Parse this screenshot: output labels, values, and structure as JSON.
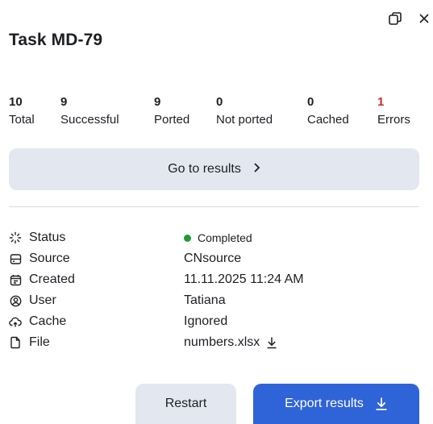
{
  "header": {
    "title": "Task MD-79"
  },
  "stats": [
    {
      "value": "10",
      "label": "Total"
    },
    {
      "value": "9",
      "label": "Successful"
    },
    {
      "value": "9",
      "label": "Ported"
    },
    {
      "value": "0",
      "label": "Not ported"
    },
    {
      "value": "0",
      "label": "Cached"
    },
    {
      "value": "1",
      "label": "Errors"
    }
  ],
  "actions": {
    "goto_results": "Go to results",
    "restart": "Restart",
    "export_results": "Export results"
  },
  "details": {
    "status": {
      "label": "Status",
      "value": "Completed",
      "icon": "spinner-icon"
    },
    "source": {
      "label": "Source",
      "value": "CNsource",
      "icon": "source-icon"
    },
    "created": {
      "label": "Created",
      "value": "11.11.2025 11:24 AM",
      "icon": "calendar-icon"
    },
    "user": {
      "label": "User",
      "value": "Tatiana",
      "icon": "user-icon"
    },
    "cache": {
      "label": "Cache",
      "value": "Ignored",
      "icon": "cloud-icon"
    },
    "file": {
      "label": "File",
      "value": "numbers.xlsx",
      "icon": "file-icon"
    }
  },
  "colors": {
    "accent": "#2f63d8",
    "error": "#d62b2b",
    "status_ok": "#1e9a3a",
    "button_secondary": "#e3e7ef"
  }
}
